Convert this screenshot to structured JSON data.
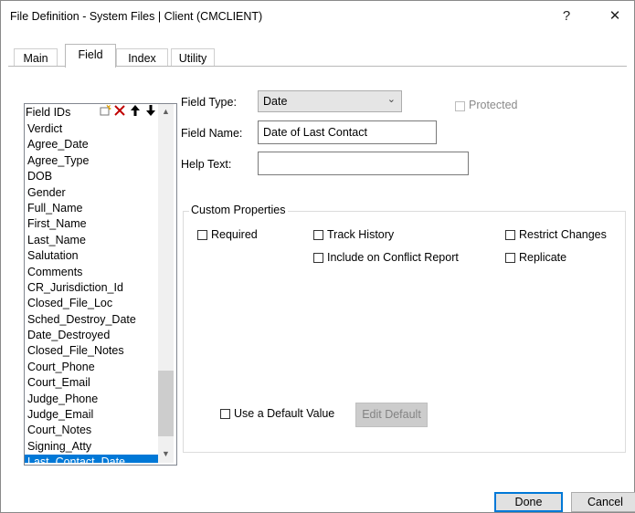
{
  "window": {
    "title": "File Definition - System Files | Client (CMCLIENT)",
    "help_glyph": "?",
    "close_glyph": "✕"
  },
  "tabs": [
    {
      "label": "Main"
    },
    {
      "label": "Field"
    },
    {
      "label": "Index"
    },
    {
      "label": "Utility"
    }
  ],
  "field_list": {
    "header": "Field IDs",
    "icons": {
      "new": "new-field-icon",
      "delete": "delete-x-icon",
      "up": "arrow-up-icon",
      "down": "arrow-down-icon"
    },
    "items": [
      "Verdict",
      "Agree_Date",
      "Agree_Type",
      "DOB",
      "Gender",
      "Full_Name",
      "First_Name",
      "Last_Name",
      "Salutation",
      "Comments",
      "CR_Jurisdiction_Id",
      "Closed_File_Loc",
      "Sched_Destroy_Date",
      "Date_Destroyed",
      "Closed_File_Notes",
      "Court_Phone",
      "Court_Email",
      "Judge_Phone",
      "Judge_Email",
      "Court_Notes",
      "Signing_Atty",
      "Last_Contact_Date"
    ],
    "selected": "Last_Contact_Date"
  },
  "form": {
    "field_type_label": "Field Type:",
    "field_type_value": "Date",
    "protected_label": "Protected",
    "field_name_label": "Field Name:",
    "field_name_value": "Date of Last Contact",
    "help_text_label": "Help Text:",
    "help_text_value": ""
  },
  "custom_properties": {
    "title": "Custom Properties",
    "required": "Required",
    "track_history": "Track History",
    "restrict_changes": "Restrict Changes",
    "include_conflict": "Include on Conflict Report",
    "replicate": "Replicate",
    "use_default": "Use a Default Value",
    "edit_default": "Edit Default"
  },
  "buttons": {
    "done": "Done",
    "cancel": "Cancel"
  },
  "colors": {
    "selection": "#0078d7",
    "button_face": "#e1e1e1"
  }
}
